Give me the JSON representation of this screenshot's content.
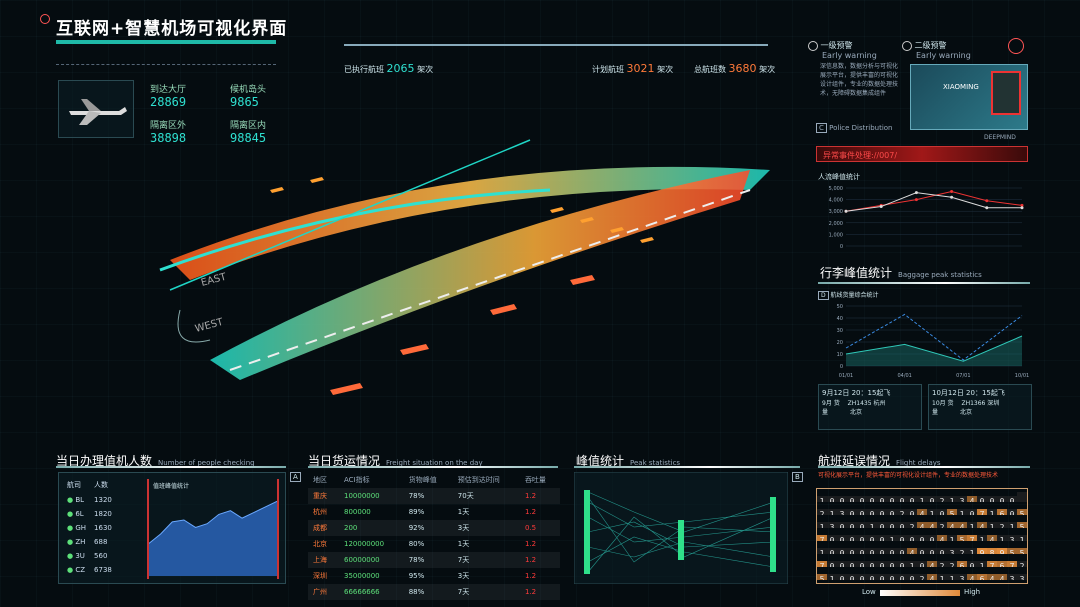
{
  "header": {
    "title": "互联网+智慧机场可视化界面"
  },
  "top_stats": [
    {
      "label": "到达大厅",
      "value": "28869"
    },
    {
      "label": "候机岛头",
      "value": "9865"
    },
    {
      "label": "隔离区外",
      "value": "38898"
    },
    {
      "label": "隔离区内",
      "value": "98845"
    }
  ],
  "flights": {
    "executed_label": "已执行航班",
    "executed_value": "2065",
    "executed_unit": "架次",
    "planned_label": "计划航班",
    "planned_value": "3021",
    "planned_unit": "架次",
    "total_label": "总航班数",
    "total_value": "3680",
    "total_unit": "架次"
  },
  "warnings": {
    "w1_title": "一级预警",
    "w1_sub": "Early warning",
    "w2_title": "二级预警",
    "w2_sub": "Early warning",
    "body": "深信息数，数据分析与可视化展示平台，提供丰富的可视化设计组件，专业的数据处理技术，无障碍数据集成组件",
    "police": "Police Distribution",
    "camera_name": "XIAOMING",
    "brand": "DEEPMIND"
  },
  "anomaly": {
    "label": "异常事件处理://007/"
  },
  "people_chart": {
    "title": "人流峰值统计"
  },
  "baggage": {
    "title": "行李峰值统计",
    "subtitle": "Baggage peak statistics",
    "sub_label": "航线货量综合统计",
    "cards": [
      {
        "time": "9月12日 20：15起飞",
        "line1": "9月 货",
        "flight": "ZH1435 杭州",
        "city": "北京",
        "line2": "量"
      },
      {
        "time": "10月12日 20：15起飞",
        "line1": "10月 货",
        "flight": "ZH1366 深圳",
        "city": "北京",
        "line2": "量"
      }
    ]
  },
  "checkin": {
    "title": "当日办理值机人数",
    "subtitle": "Number of people checking",
    "marker": "A",
    "col1": "航司",
    "col2": "人数",
    "chart_label": "值班峰值统计",
    "rows": [
      {
        "code": "BL",
        "num": "1320"
      },
      {
        "code": "6L",
        "num": "1820"
      },
      {
        "code": "GH",
        "num": "1630"
      },
      {
        "code": "ZH",
        "num": "688"
      },
      {
        "code": "3U",
        "num": "560"
      },
      {
        "code": "CZ",
        "num": "6738"
      }
    ]
  },
  "freight": {
    "title": "当日货运情况",
    "subtitle": "Freight situation on the day",
    "headers": [
      "地区",
      "ACI指标",
      "货物峰值",
      "预估到达时间",
      "吞吐量"
    ],
    "rows": [
      [
        "重庆",
        "10000000",
        "78%",
        "70天",
        "1.2"
      ],
      [
        "杭州",
        "800000",
        "89%",
        "1天",
        "1.2"
      ],
      [
        "成都",
        "200",
        "92%",
        "3天",
        "0.5"
      ],
      [
        "北京",
        "120000000",
        "80%",
        "1天",
        "1.2"
      ],
      [
        "上海",
        "60000000",
        "78%",
        "7天",
        "1.2"
      ],
      [
        "深圳",
        "35000000",
        "95%",
        "3天",
        "1.2"
      ],
      [
        "广州",
        "66666666",
        "88%",
        "7天",
        "1.2"
      ]
    ]
  },
  "peak": {
    "title": "峰值统计",
    "subtitle": "Peak statistics",
    "marker": "B"
  },
  "delay": {
    "title": "航班延误情况",
    "subtitle": "Flight delays",
    "desc": "可视化展示平台，提供丰富的可视化设计组件，专业的数据处理技术",
    "low": "Low",
    "high": "High",
    "marker": "C",
    "marker2": "D",
    "rows": [
      "10000000001021340000 1226",
      "2130000020410510716053420",
      "1300010002442441412153730",
      "7000000100004157141312954456",
      "1000000004000321989557424",
      "7000000001042260176728727",
      "5100000000241134644332 5"
    ]
  },
  "chart_data": [
    {
      "type": "line",
      "title": "人流峰值统计",
      "ylim": [
        0,
        5000
      ],
      "yticks": [
        "5,000",
        "4,000",
        "3,000",
        "2,000",
        "1,000",
        "0"
      ],
      "series": [
        {
          "values": [
            3000,
            3500,
            4000,
            4700,
            3900,
            3500
          ]
        },
        {
          "values": [
            3000,
            3400,
            4600,
            4200,
            3300,
            3300
          ]
        }
      ]
    },
    {
      "type": "line",
      "ylim": [
        0,
        50
      ],
      "yticks": [
        "50",
        "40",
        "30",
        "20",
        "10",
        "0"
      ],
      "categories": [
        "01/01",
        "04/01",
        "07/01",
        "10/01"
      ],
      "series": [
        {
          "values": [
            15,
            43,
            5,
            42
          ]
        },
        {
          "values": [
            10,
            18,
            4,
            25
          ]
        }
      ]
    },
    {
      "type": "area",
      "title": "值班峰值统计",
      "series": [
        {
          "values": [
            35,
            45,
            58,
            60,
            52,
            56,
            66,
            70,
            62,
            68,
            74,
            80
          ]
        }
      ]
    }
  ]
}
